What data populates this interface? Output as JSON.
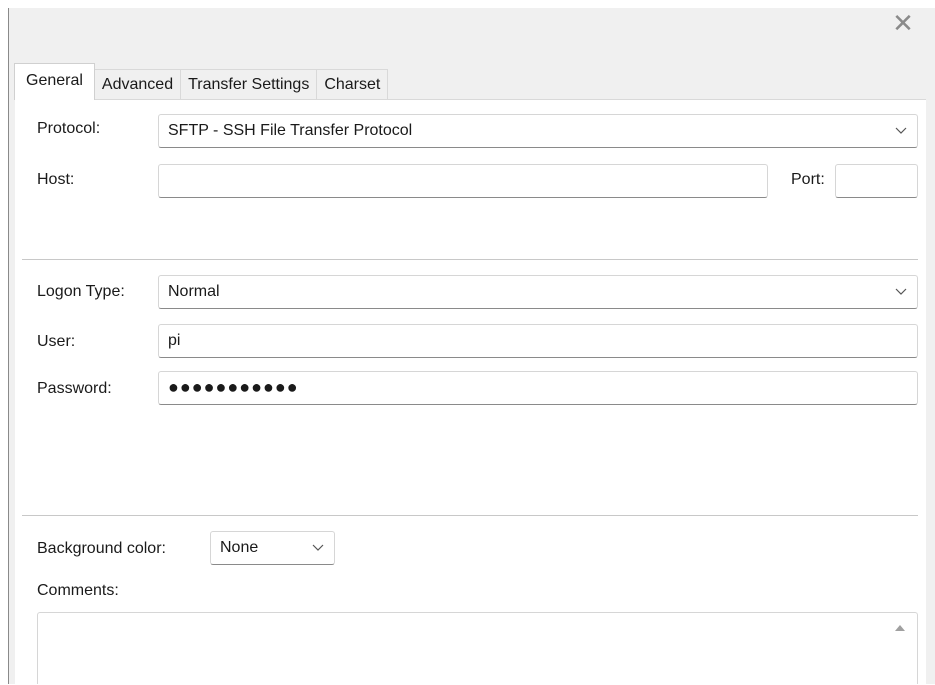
{
  "tabs": [
    {
      "label": "General",
      "active": true
    },
    {
      "label": "Advanced",
      "active": false
    },
    {
      "label": "Transfer Settings",
      "active": false
    },
    {
      "label": "Charset",
      "active": false
    }
  ],
  "general": {
    "protocol_label": "Protocol:",
    "protocol_value": "SFTP - SSH File Transfer Protocol",
    "host_label": "Host:",
    "host_value": "",
    "port_label": "Port:",
    "port_value": "",
    "logon_type_label": "Logon Type:",
    "logon_type_value": "Normal",
    "user_label": "User:",
    "user_value": "pi",
    "password_label": "Password:",
    "password_value": "●●●●●●●●●●●",
    "background_color_label": "Background color:",
    "background_color_value": "None",
    "comments_label": "Comments:",
    "comments_value": ""
  },
  "icons": {
    "close": "close-icon",
    "dropdown": "chevron-down-icon",
    "scroll_up": "scroll-up-arrow-icon"
  },
  "colors": {
    "panel_background": "#ffffff",
    "window_background": "#f0f0f0",
    "border": "#d6d6d6"
  }
}
